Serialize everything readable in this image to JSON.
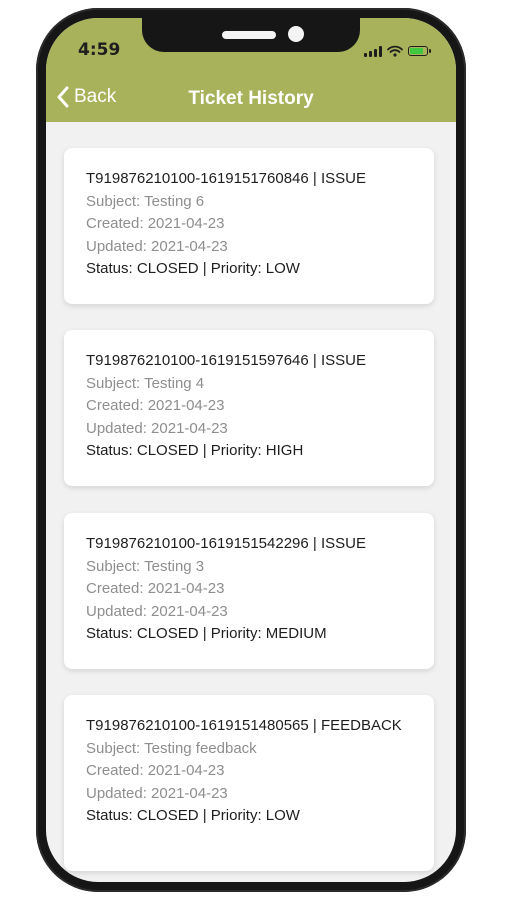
{
  "status_bar": {
    "time": "4:59"
  },
  "header": {
    "back_label": "Back",
    "title": "Ticket History"
  },
  "tickets": [
    {
      "id_line": "T919876210100-1619151760846  |  ISSUE",
      "subject": "Subject: Testing 6",
      "created": "Created: 2021-04-23",
      "updated": "Updated: 2021-04-23",
      "status": "Status: CLOSED | Priority: LOW"
    },
    {
      "id_line": "T919876210100-1619151597646  |  ISSUE",
      "subject": "Subject: Testing 4",
      "created": "Created: 2021-04-23",
      "updated": "Updated: 2021-04-23",
      "status": "Status: CLOSED | Priority: HIGH"
    },
    {
      "id_line": "T919876210100-1619151542296  |  ISSUE",
      "subject": "Subject: Testing 3",
      "created": "Created: 2021-04-23",
      "updated": "Updated: 2021-04-23",
      "status": "Status: CLOSED | Priority: MEDIUM"
    },
    {
      "id_line": "T919876210100-1619151480565  |  FEEDBACK",
      "subject": "Subject: Testing feedback",
      "created": "Created: 2021-04-23",
      "updated": "Updated: 2021-04-23",
      "status": "Status: CLOSED | Priority: LOW"
    }
  ],
  "colors": {
    "header": "#a7b25a",
    "background": "#f1f1f1",
    "muted_text": "#8e8e8e"
  },
  "icons": [
    "chevron-left-icon",
    "signal-icon",
    "wifi-icon",
    "battery-charging-icon"
  ]
}
